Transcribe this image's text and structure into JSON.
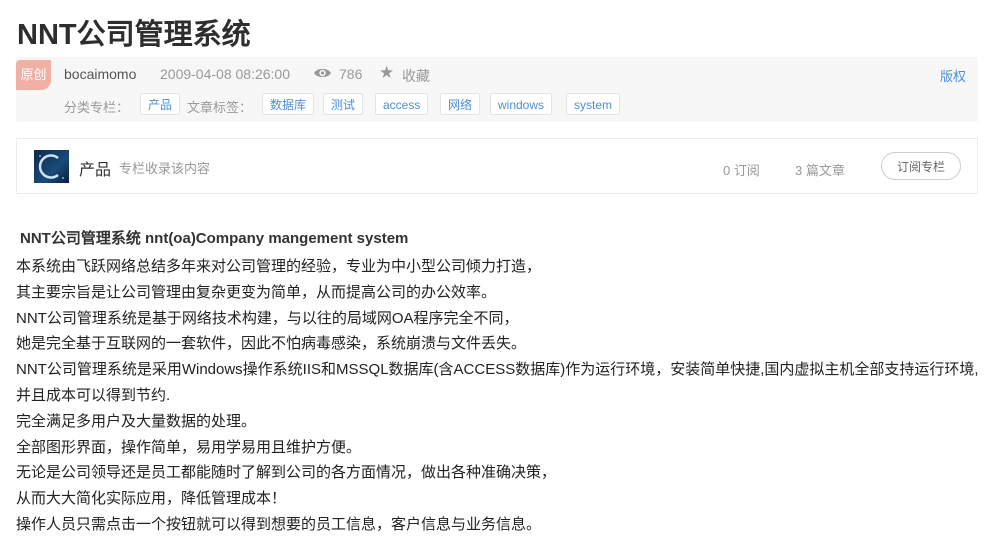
{
  "page": {
    "title": "NNT公司管理系统"
  },
  "meta": {
    "badge": "原创",
    "author": "bocaimomo",
    "date": "2009-04-08 08:26:00",
    "views": "786",
    "collect_label": "收藏",
    "copyright_label": "版权",
    "category_label": "分类专栏：",
    "category": "产品",
    "tags_label": "文章标签：",
    "tags": [
      "数据库",
      "测试",
      "access",
      "网络",
      "windows",
      "system"
    ]
  },
  "column": {
    "name": "产品",
    "description": "专栏收录该内容",
    "subscribers": "0 订阅",
    "articles": "3 篇文章",
    "subscribe_button": "订阅专栏"
  },
  "article": {
    "heading": "NNT公司管理系统 nnt(oa)Company mangement system",
    "paragraphs": [
      "本系统由飞跃网络总结多年来对公司管理的经验，专业为中小型公司倾力打造，",
      "其主要宗旨是让公司管理由复杂更变为简单，从而提高公司的办公效率。",
      "NNT公司管理系统是基于网络技术构建，与以往的局域网OA程序完全不同，",
      "她是完全基于互联网的一套软件，因此不怕病毒感染，系统崩溃与文件丢失。",
      "NNT公司管理系统是采用Windows操作系统IIS和MSSQL数据库(含ACCESS数据库)作为运行环境，安装简单快捷,国内虚拟主机全部支持运行环境,并且成本可以得到节约.",
      "完全满足多用户及大量数据的处理。",
      "全部图形界面，操作简单，易用学易用且维护方便。",
      "无论是公司领导还是员工都能随时了解到公司的各方面情况，做出各种准确决策，",
      "从而大大简化实际应用，降低管理成本！",
      "操作人员只需点击一个按钮就可以得到想要的员工信息，客户信息与业务信息。"
    ]
  },
  "colors": {
    "accent": "#4e8fd4",
    "badge_bg": "#f1b0a5",
    "meta_bg": "#f7f7f7"
  }
}
